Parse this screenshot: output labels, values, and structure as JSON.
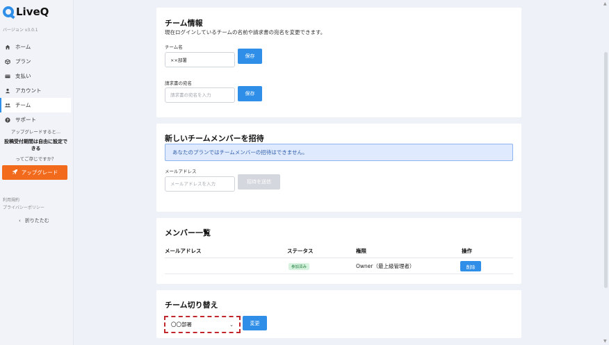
{
  "app": {
    "name": "LiveQ",
    "version": "バージョン v3.0.1"
  },
  "sidebar": {
    "items": [
      {
        "label": "ホーム",
        "icon": "home-icon"
      },
      {
        "label": "プラン",
        "icon": "box-icon"
      },
      {
        "label": "支払い",
        "icon": "card-icon"
      },
      {
        "label": "アカウント",
        "icon": "user-icon"
      },
      {
        "label": "チーム",
        "icon": "team-icon",
        "active": true
      },
      {
        "label": "サポート",
        "icon": "help-icon"
      }
    ],
    "promo": {
      "line1": "アップグレードすると...",
      "line2": "投稿受付期間は自由に設定できる",
      "line3": "ってご存じですか？",
      "button": "アップグレード"
    },
    "footer": {
      "terms": "利用規約",
      "privacy": "プライバシーポリシー"
    },
    "collapse": "折りたたむ"
  },
  "team_info": {
    "title": "チーム情報",
    "description": "現在ログインしているチームの名前や請求書の宛名を変更できます。",
    "name_label": "チーム名",
    "name_value": "××部署",
    "save_label": "保存",
    "invoice_label": "請求書の宛名",
    "invoice_placeholder": "請求書の宛名を入力",
    "invoice_save_label": "保存"
  },
  "invite": {
    "title": "新しいチームメンバーを招待",
    "notice": "あなたのプランではチームメンバーの招待はできません。",
    "email_label": "メールアドレス",
    "email_placeholder": "メールアドレスを入力",
    "send_label": "招待を送信"
  },
  "members": {
    "title": "メンバー一覧",
    "columns": [
      "メールアドレス",
      "ステータス",
      "権限",
      "操作"
    ],
    "rows": [
      {
        "email": "",
        "status": "参加済み",
        "role": "Owner（最上級管理者）",
        "action": "削除"
      }
    ]
  },
  "switch": {
    "title": "チーム切り替え",
    "selected": "〇〇部署",
    "button": "変更"
  },
  "colors": {
    "accent": "#2f8fe8",
    "upgrade": "#f26a1b",
    "highlight": "#c0262a"
  }
}
